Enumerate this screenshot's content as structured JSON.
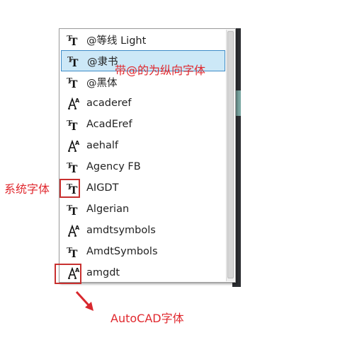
{
  "font_list": {
    "items": [
      {
        "label": "@等线 Light",
        "icon": "truetype-font-icon",
        "selected": false
      },
      {
        "label": "@隶书",
        "icon": "truetype-font-icon",
        "selected": true
      },
      {
        "label": "@黑体",
        "icon": "truetype-font-icon",
        "selected": false
      },
      {
        "label": "acaderef",
        "icon": "autocad-shx-font-icon",
        "selected": false
      },
      {
        "label": "AcadEref",
        "icon": "truetype-font-icon",
        "selected": false
      },
      {
        "label": "aehalf",
        "icon": "autocad-shx-font-icon",
        "selected": false
      },
      {
        "label": "Agency FB",
        "icon": "truetype-font-icon",
        "selected": false
      },
      {
        "label": "AIGDT",
        "icon": "truetype-font-icon",
        "selected": false
      },
      {
        "label": "Algerian",
        "icon": "truetype-font-icon",
        "selected": false
      },
      {
        "label": "amdtsymbols",
        "icon": "autocad-shx-font-icon",
        "selected": false
      },
      {
        "label": "AmdtSymbols",
        "icon": "truetype-font-icon",
        "selected": false
      },
      {
        "label": "amgdt",
        "icon": "autocad-shx-font-icon",
        "selected": false
      }
    ]
  },
  "annotations": {
    "vertical_font_note": "带@的为纵向字体",
    "system_font_note": "系统字体",
    "autocad_font_note": "AutoCAD字体",
    "color": "#e0282e"
  }
}
